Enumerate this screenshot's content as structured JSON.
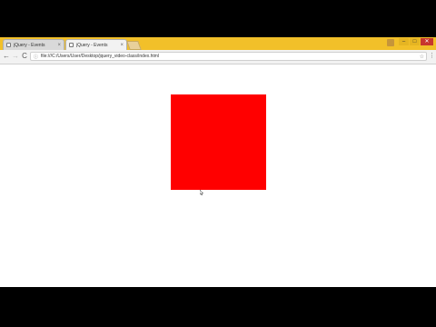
{
  "browser": {
    "tabs": [
      {
        "title": "jQuery - Events",
        "active": false
      },
      {
        "title": "jQuery - Events",
        "active": true
      }
    ],
    "toolbar": {
      "back": "←",
      "forward": "→",
      "reload": "C",
      "address": "file:///C:/Users/User/Desktop/jquery_video-class/index.html",
      "info_icon": "ⓘ",
      "star_icon": "☆",
      "menu_icon": "⋮"
    },
    "window_controls": {
      "minimize": "–",
      "maximize": "□",
      "close": "✕"
    },
    "tab_close": "×"
  },
  "page": {
    "box_color": "#ff0000",
    "background": "#ffffff"
  }
}
